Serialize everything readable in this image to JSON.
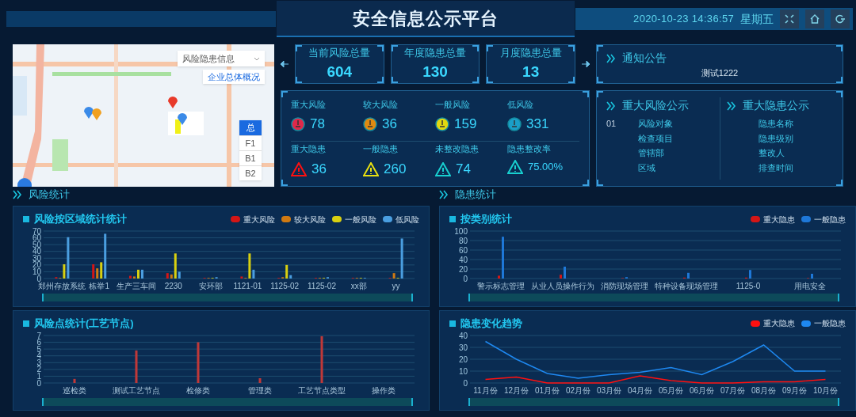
{
  "header": {
    "title": "安全信息公示平台",
    "datetime": "2020-10-23 14:36:57",
    "weekday": "星期五"
  },
  "map": {
    "dropdown": "风险隐患信息",
    "overview_button": "企业总体概况",
    "floors": [
      {
        "label": "总",
        "selected": true
      },
      {
        "label": "F1",
        "selected": false
      },
      {
        "label": "B1",
        "selected": false
      },
      {
        "label": "B2",
        "selected": false
      }
    ]
  },
  "totals": [
    {
      "label": "当前风险总量",
      "value": "604"
    },
    {
      "label": "年度隐患总量",
      "value": "130"
    },
    {
      "label": "月度隐患总量",
      "value": "13"
    }
  ],
  "risks": [
    {
      "label": "重大风险",
      "value": "78",
      "color": "#e0284a"
    },
    {
      "label": "较大风险",
      "value": "36",
      "color": "#e08a10"
    },
    {
      "label": "一般风险",
      "value": "159",
      "color": "#e0d810"
    },
    {
      "label": "低风险",
      "value": "331",
      "color": "#1a9fc8"
    }
  ],
  "hazards": [
    {
      "label": "重大隐患",
      "value": "36",
      "color": "#ff1010"
    },
    {
      "label": "一般隐患",
      "value": "260",
      "color": "#e8e010"
    },
    {
      "label": "未整改隐患",
      "value": "74",
      "color": "#18d0d0"
    },
    {
      "label": "隐患整改率",
      "value": "75.00%",
      "color": "#18d0d0"
    }
  ],
  "notice": {
    "title": "通知公告",
    "text": "测试1222"
  },
  "major_risk": {
    "title": "重大风险公示",
    "index": "01",
    "fields": [
      "风险对象",
      "检查项目",
      "管辖部",
      "区域"
    ]
  },
  "major_hazard": {
    "title": "重大隐患公示",
    "fields": [
      "隐患名称",
      "隐患级别",
      "整改人",
      "排查时间"
    ]
  },
  "sections": [
    "风险统计",
    "隐患统计"
  ],
  "panels": [
    {
      "slider": {
        "level": 1
      },
      "chart_data": {
        "type": "bar",
        "grid": true,
        "ylim": [
          0,
          70
        ],
        "title": "风险按区域统计统计",
        "categories": [
          "郑州存放系统",
          "栋举1",
          "生产三车间",
          "2230",
          "安环部",
          "1121-01",
          "1125-02",
          "1125-02",
          "xx部",
          "yy"
        ],
        "yticks": [
          0,
          10,
          20,
          30,
          40,
          50,
          60,
          70
        ],
        "series": [
          {
            "name": "重大风险",
            "color": "#d41616",
            "values": [
              2,
              21,
              4,
              8,
              1,
              3,
              1,
              1,
              1,
              1
            ]
          },
          {
            "name": "较大风险",
            "color": "#d07a12",
            "values": [
              1,
              15,
              3,
              6,
              1,
              1,
              2,
              1,
              1,
              8
            ]
          },
          {
            "name": "一般风险",
            "color": "#d8d010",
            "values": [
              21,
              24,
              13,
              37,
              1,
              37,
              20,
              1,
              1,
              1
            ]
          },
          {
            "name": "低风险",
            "color": "#4a9ee0",
            "values": [
              61,
              66,
              13,
              10,
              2,
              13,
              5,
              2,
              1,
              59
            ]
          }
        ]
      }
    },
    {
      "slider": {
        "level": 1
      },
      "chart_data": {
        "type": "bar",
        "grid": true,
        "ylim": [
          0,
          7
        ],
        "title": "风险点统计(工艺节点)",
        "categories": [
          "巡检类",
          "测试工艺节点",
          "检修类",
          "管理类",
          "工艺节点类型",
          "操作类"
        ],
        "yticks": [
          0,
          1,
          2,
          3,
          4,
          5,
          6,
          7
        ],
        "series": [
          {
            "color": "#c03838",
            "values": [
              0.6,
              4.8,
              6,
              0.7,
              6.9,
              0
            ]
          }
        ]
      }
    },
    {
      "slider": {
        "level": 1
      },
      "chart_data": {
        "type": "bar",
        "grid": true,
        "ylim": [
          0,
          100
        ],
        "title": "按类别统计",
        "categories": [
          "警示标志管理",
          "从业人员操作行为",
          "消防现场管理",
          "特种设备现场管理",
          "1125-0",
          "用电安全"
        ],
        "yticks": [
          0,
          20,
          40,
          60,
          80,
          100
        ],
        "series": [
          {
            "name": "重大隐患",
            "color": "#d41616",
            "values": [
              6,
              8,
              1,
              2,
              2,
              1
            ]
          },
          {
            "name": "一般隐患",
            "color": "#1e78d8",
            "values": [
              88,
              25,
              3,
              12,
              18,
              10
            ]
          }
        ]
      }
    },
    {
      "slider": {
        "level": 1
      },
      "chart_data": {
        "type": "line",
        "grid": true,
        "ylim": [
          0,
          40
        ],
        "title": "隐患变化趋势",
        "categories": [
          "11月份",
          "12月份",
          "01月份",
          "02月份",
          "03月份",
          "04月份",
          "05月份",
          "06月份",
          "07月份",
          "08月份",
          "09月份",
          "10月份"
        ],
        "yticks": [
          0,
          10,
          20,
          30,
          40
        ],
        "series": [
          {
            "name": "重大隐患",
            "color": "#ff1010",
            "values": [
              3,
              5,
              0,
              0,
              0,
              6,
              2,
              0,
              0,
              1,
              1,
              3
            ]
          },
          {
            "name": "一般隐患",
            "color": "#1e88f0",
            "values": [
              35,
              20,
              8,
              4,
              7,
              9,
              13,
              7,
              18,
              32,
              10,
              10
            ]
          }
        ]
      }
    }
  ]
}
